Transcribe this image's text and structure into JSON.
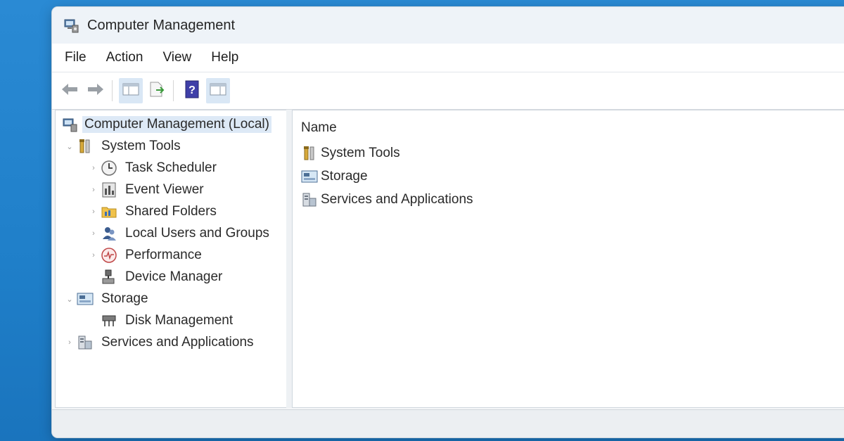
{
  "window": {
    "title": "Computer Management"
  },
  "menu": [
    "File",
    "Action",
    "View",
    "Help"
  ],
  "toolbar": {
    "buttons": [
      {
        "name": "back-arrow-icon"
      },
      {
        "name": "forward-arrow-icon"
      },
      {
        "name": "show-hide-console-tree-icon"
      },
      {
        "name": "export-list-icon"
      },
      {
        "name": "help-icon"
      },
      {
        "name": "show-hide-action-pane-icon"
      }
    ]
  },
  "tree": {
    "root": "Computer Management (Local)",
    "items": [
      {
        "label": "System Tools",
        "icon": "tools-icon",
        "expander": "⌄"
      },
      {
        "label": "Task Scheduler",
        "icon": "clock-icon",
        "expander": "›"
      },
      {
        "label": "Event Viewer",
        "icon": "event-viewer-icon",
        "expander": "›"
      },
      {
        "label": "Shared Folders",
        "icon": "shared-folders-icon",
        "expander": "›"
      },
      {
        "label": "Local Users and Groups",
        "icon": "users-icon",
        "expander": "›"
      },
      {
        "label": "Performance",
        "icon": "performance-icon",
        "expander": "›"
      },
      {
        "label": "Device Manager",
        "icon": "device-manager-icon",
        "expander": ""
      },
      {
        "label": "Storage",
        "icon": "storage-icon",
        "expander": "⌄"
      },
      {
        "label": "Disk Management",
        "icon": "disk-management-icon",
        "expander": ""
      },
      {
        "label": "Services and Applications",
        "icon": "services-icon",
        "expander": "›"
      }
    ]
  },
  "list": {
    "column_name": "Name",
    "rows": [
      "System Tools",
      "Storage",
      "Services and Applications"
    ]
  },
  "colors": {
    "desktop": "#1f7fc9",
    "selection": "#dde9f6",
    "pressed_button": "#d9e7f5"
  }
}
